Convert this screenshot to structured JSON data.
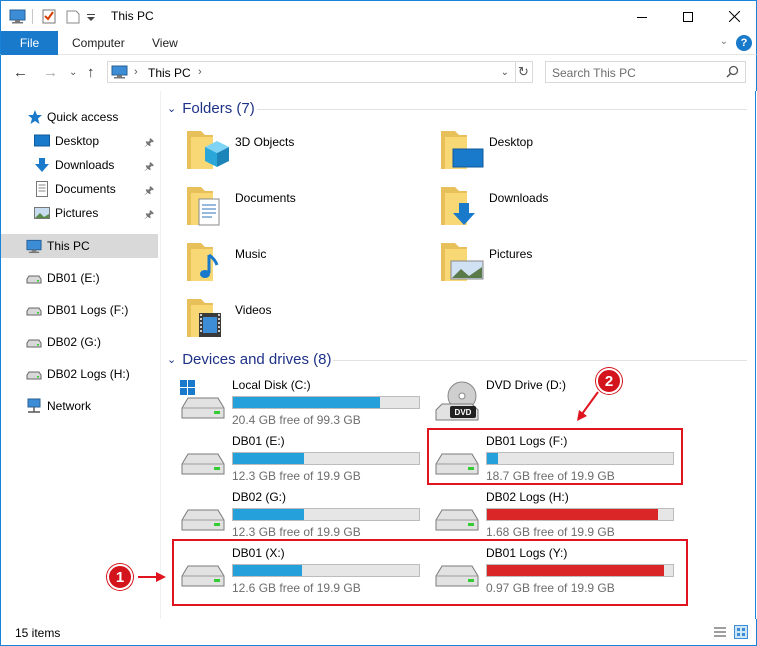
{
  "window": {
    "title": "This PC"
  },
  "ribbon": {
    "file": "File",
    "tabs": [
      "Computer",
      "View"
    ],
    "help": "?"
  },
  "address": {
    "path": "This PC",
    "search_placeholder": "Search This PC"
  },
  "nav": {
    "quick_access": "Quick access",
    "pinned": [
      "Desktop",
      "Downloads",
      "Documents",
      "Pictures"
    ],
    "this_pc": "This PC",
    "drives": [
      "DB01 (E:)",
      "DB01 Logs (F:)",
      "DB02 (G:)",
      "DB02 Logs (H:)"
    ],
    "network": "Network"
  },
  "folders": {
    "heading": "Folders (7)",
    "items": [
      "3D Objects",
      "Desktop",
      "Documents",
      "Downloads",
      "Music",
      "Pictures",
      "Videos"
    ]
  },
  "devices": {
    "heading": "Devices and drives (8)",
    "items": [
      {
        "name": "Local Disk (C:)",
        "free": "20.4 GB free of 99.3 GB",
        "used_fraction": 0.79,
        "status": "normal",
        "icon": "windows-drive-icon"
      },
      {
        "name": "DVD Drive (D:)",
        "free": "",
        "used_fraction": null,
        "status": "none",
        "icon": "dvd-drive-icon"
      },
      {
        "name": "DB01 (E:)",
        "free": "12.3 GB free of 19.9 GB",
        "used_fraction": 0.38,
        "status": "normal",
        "icon": "hard-drive-icon"
      },
      {
        "name": "DB01 Logs (F:)",
        "free": "18.7 GB free of 19.9 GB",
        "used_fraction": 0.06,
        "status": "normal",
        "icon": "hard-drive-icon"
      },
      {
        "name": "DB02 (G:)",
        "free": "12.3 GB free of 19.9 GB",
        "used_fraction": 0.38,
        "status": "normal",
        "icon": "hard-drive-icon"
      },
      {
        "name": "DB02 Logs (H:)",
        "free": "1.68 GB free of 19.9 GB",
        "used_fraction": 0.92,
        "status": "critical",
        "icon": "hard-drive-icon"
      },
      {
        "name": "DB01 (X:)",
        "free": "12.6 GB free of 19.9 GB",
        "used_fraction": 0.37,
        "status": "normal",
        "icon": "hard-drive-icon"
      },
      {
        "name": "DB01 Logs (Y:)",
        "free": "0.97 GB free of 19.9 GB",
        "used_fraction": 0.95,
        "status": "critical",
        "icon": "hard-drive-icon"
      }
    ]
  },
  "annotations": {
    "badge1": "1",
    "badge2": "2"
  },
  "status": {
    "items": "15 items"
  },
  "colors": {
    "accent": "#1979ca",
    "bar_normal": "#26a0da",
    "bar_critical": "#da2626",
    "annotation": "#e0141e"
  }
}
